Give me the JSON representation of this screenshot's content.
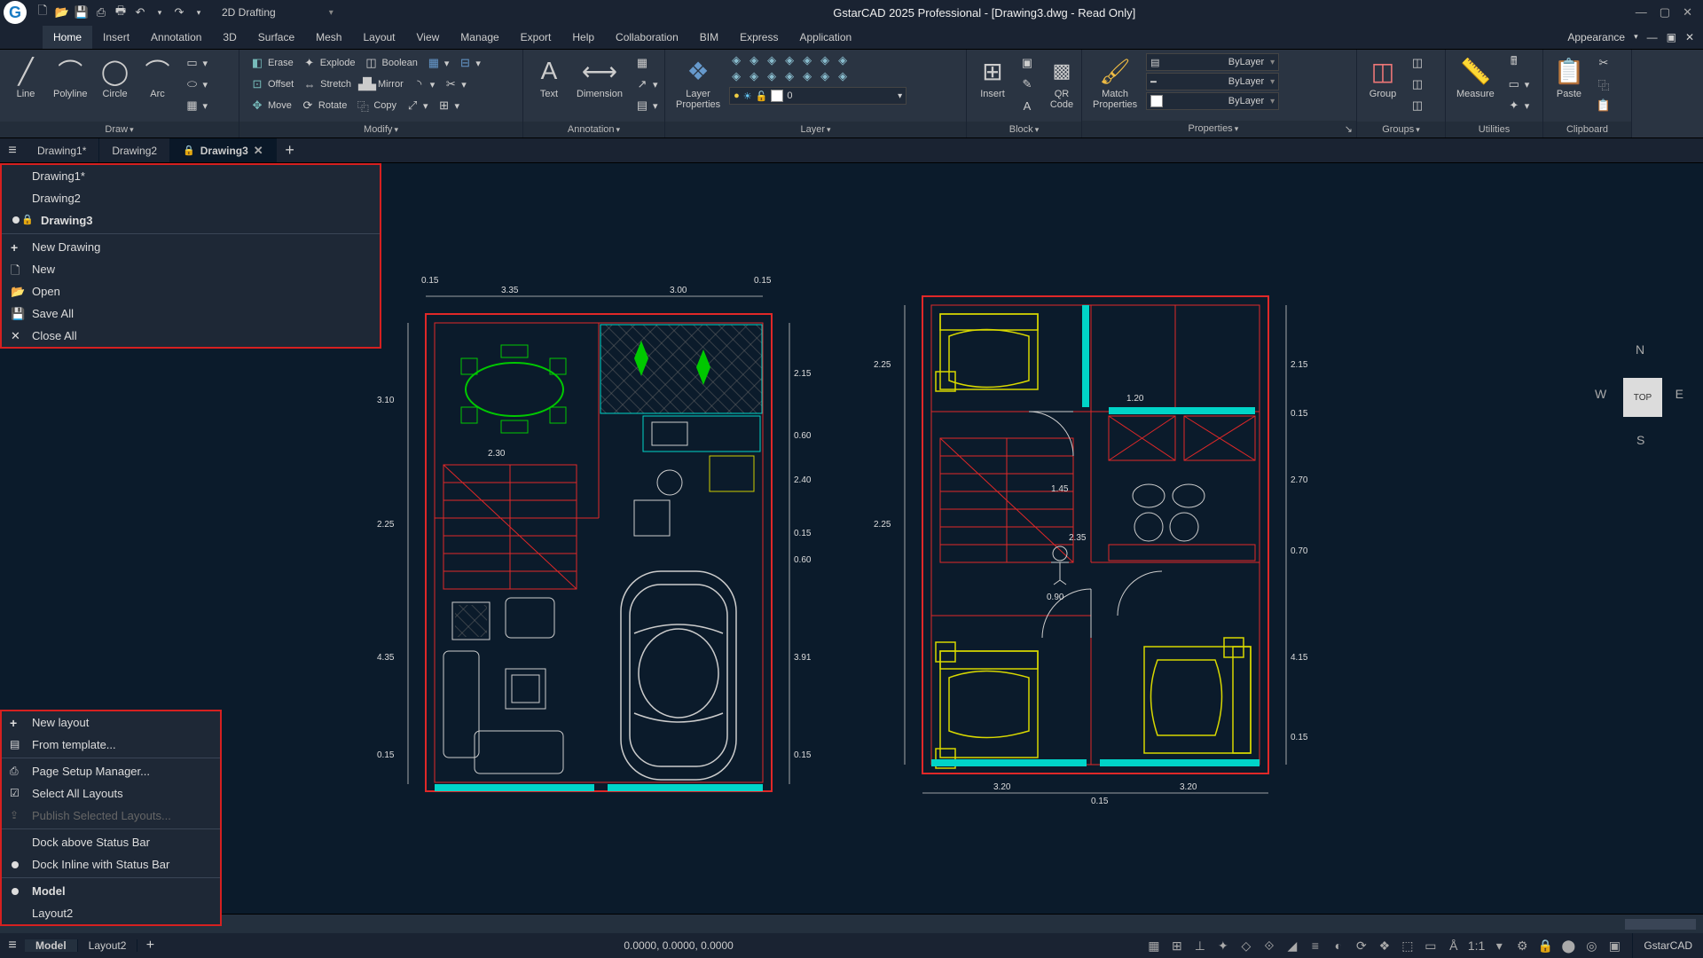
{
  "titlebar": {
    "workspace": "2D Drafting",
    "title": "GstarCAD 2025 Professional - [Drawing3.dwg - Read Only]",
    "appearance": "Appearance"
  },
  "menu": {
    "items": [
      "Home",
      "Insert",
      "Annotation",
      "3D",
      "Surface",
      "Mesh",
      "Layout",
      "View",
      "Manage",
      "Export",
      "Help",
      "Collaboration",
      "BIM",
      "Express",
      "Application"
    ]
  },
  "ribbon": {
    "draw": {
      "label": "Draw",
      "line": "Line",
      "polyline": "Polyline",
      "circle": "Circle",
      "arc": "Arc"
    },
    "modify": {
      "label": "Modify",
      "erase": "Erase",
      "explode": "Explode",
      "boolean": "Boolean",
      "offset": "Offset",
      "stretch": "Stretch",
      "mirror": "Mirror",
      "move": "Move",
      "rotate": "Rotate",
      "copy": "Copy"
    },
    "annotation": {
      "label": "Annotation",
      "text": "Text",
      "dimension": "Dimension"
    },
    "layer": {
      "label": "Layer",
      "layerprops": "Layer\nProperties",
      "current": "0"
    },
    "block": {
      "label": "Block",
      "insert": "Insert",
      "qrcode": "QR\nCode"
    },
    "properties": {
      "label": "Properties",
      "match": "Match\nProperties",
      "bylayer": "ByLayer"
    },
    "group": {
      "label": "Groups",
      "group": "Group"
    },
    "utilities": {
      "label": "Utilities",
      "measure": "Measure"
    },
    "clipboard": {
      "label": "Clipboard",
      "paste": "Paste"
    }
  },
  "tabs": {
    "items": [
      {
        "label": "Drawing1*",
        "active": false,
        "locked": false
      },
      {
        "label": "Drawing2",
        "active": false,
        "locked": false
      },
      {
        "label": "Drawing3",
        "active": true,
        "locked": true
      }
    ]
  },
  "doclist": {
    "items": [
      "Drawing1*",
      "Drawing2",
      "Drawing3"
    ],
    "newdrawing": "New Drawing",
    "new": "New",
    "open": "Open",
    "saveall": "Save All",
    "closeall": "Close All"
  },
  "layout_context": {
    "newlayout": "New layout",
    "fromtemplate": "From template...",
    "pagesetup": "Page Setup Manager...",
    "selectall": "Select All Layouts",
    "publishsel": "Publish Selected Layouts...",
    "dockabove": "Dock above Status Bar",
    "dockinline": "Dock Inline with Status Bar",
    "model": "Model",
    "layout2": "Layout2"
  },
  "status": {
    "model": "Model",
    "layout2": "Layout2",
    "coords": "0.0000, 0.0000, 0.0000",
    "scale": "1:1",
    "brand": "GstarCAD"
  },
  "viewcube": {
    "top": "TOP",
    "n": "N",
    "s": "S",
    "e": "E",
    "w": "W"
  },
  "dims": {
    "left": {
      "w1": "3.35",
      "w2": "3.00",
      "w3": "0.15",
      "w4": "0.15",
      "w5": "2.30",
      "h1": "2.15",
      "h2": "0.60",
      "h3": "2.40",
      "h4": "0.15",
      "h5": "0.60",
      "h6": "3.91",
      "h7": "0.15",
      "hl1": "3.10",
      "hl2": "2.25",
      "hl3": "4.35",
      "hl4": "0.15"
    },
    "right": {
      "w1": "3.20",
      "w2": "0.15",
      "w3": "3.20",
      "d1": "1.20",
      "d2": "1.45",
      "d3": "0.90",
      "d4": "2.35",
      "h1": "2.25",
      "h2": "2.25",
      "hr1": "2.15",
      "hr2": "0.15",
      "hr3": "2.70",
      "hr4": "0.70",
      "hr5": "4.15",
      "hr6": "0.15"
    }
  }
}
